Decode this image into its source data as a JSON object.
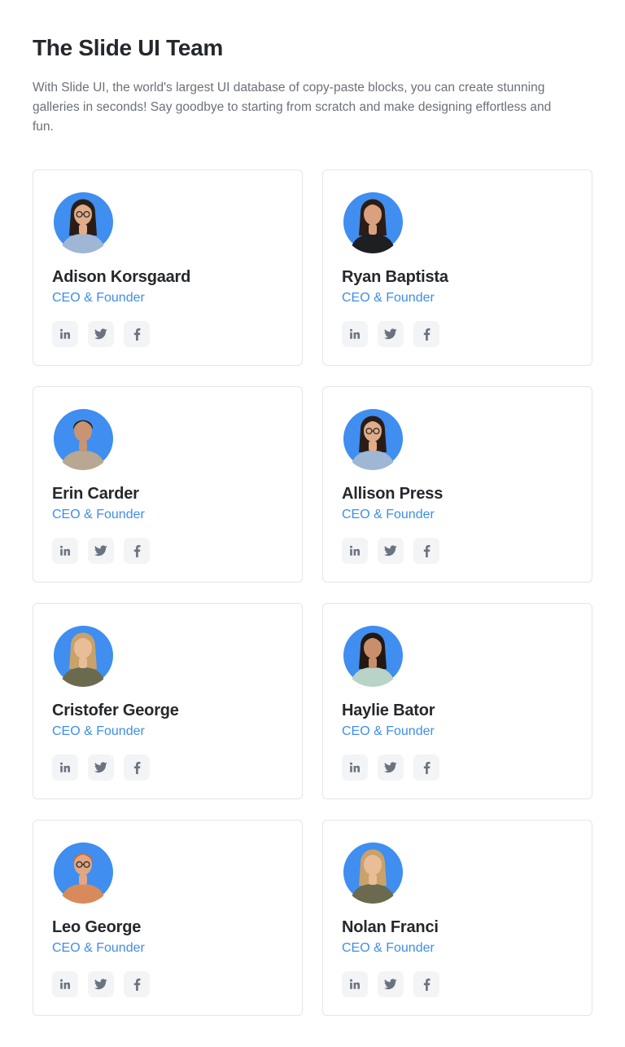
{
  "header": {
    "title": "The Slide UI Team",
    "description": "With Slide UI, the world's largest UI database of copy-paste blocks, you can create stunning galleries in seconds! Say goodbye to starting from scratch and make designing effortless and fun."
  },
  "colors": {
    "accent": "#3e8ee6",
    "avatar_bg": "#3f8ef0",
    "icon": "#6b7280",
    "icon_bg": "#f3f4f6"
  },
  "team": [
    {
      "name": "Adison Korsgaard",
      "role": "CEO & Founder",
      "avatar": {
        "skin": "#e0ac8a",
        "hair": "#2a1d16",
        "shirt": "#9fb6d4",
        "long_hair": true,
        "glasses": true
      }
    },
    {
      "name": "Ryan Baptista",
      "role": "CEO & Founder",
      "avatar": {
        "skin": "#d9a17e",
        "hair": "#2b1c15",
        "shirt": "#1d1f22",
        "long_hair": true,
        "glasses": false
      }
    },
    {
      "name": "Erin Carder",
      "role": "CEO & Founder",
      "avatar": {
        "skin": "#c99472",
        "hair": "#2c2119",
        "shirt": "#b8a891",
        "long_hair": false,
        "glasses": false
      }
    },
    {
      "name": "Allison Press",
      "role": "CEO & Founder",
      "avatar": {
        "skin": "#e0ac8a",
        "hair": "#2a1d16",
        "shirt": "#9fb6d4",
        "long_hair": true,
        "glasses": true
      }
    },
    {
      "name": "Cristofer George",
      "role": "CEO & Founder",
      "avatar": {
        "skin": "#e8bd98",
        "hair": "#c9a26a",
        "shirt": "#6b6a4e",
        "long_hair": true,
        "glasses": false
      }
    },
    {
      "name": "Haylie Bator",
      "role": "CEO & Founder",
      "avatar": {
        "skin": "#c98f6c",
        "hair": "#231813",
        "shirt": "#b9d3c6",
        "long_hair": true,
        "glasses": false
      }
    },
    {
      "name": "Leo George",
      "role": "CEO & Founder",
      "avatar": {
        "skin": "#e2a684",
        "hair": "#d06a2a",
        "shirt": "#d98a5a",
        "long_hair": false,
        "glasses": true
      }
    },
    {
      "name": "Nolan Franci",
      "role": "CEO & Founder",
      "avatar": {
        "skin": "#e8bd98",
        "hair": "#c9a26a",
        "shirt": "#6b6a4e",
        "long_hair": true,
        "glasses": false
      }
    }
  ],
  "social_icons": [
    "linkedin-icon",
    "twitter-icon",
    "facebook-icon"
  ]
}
